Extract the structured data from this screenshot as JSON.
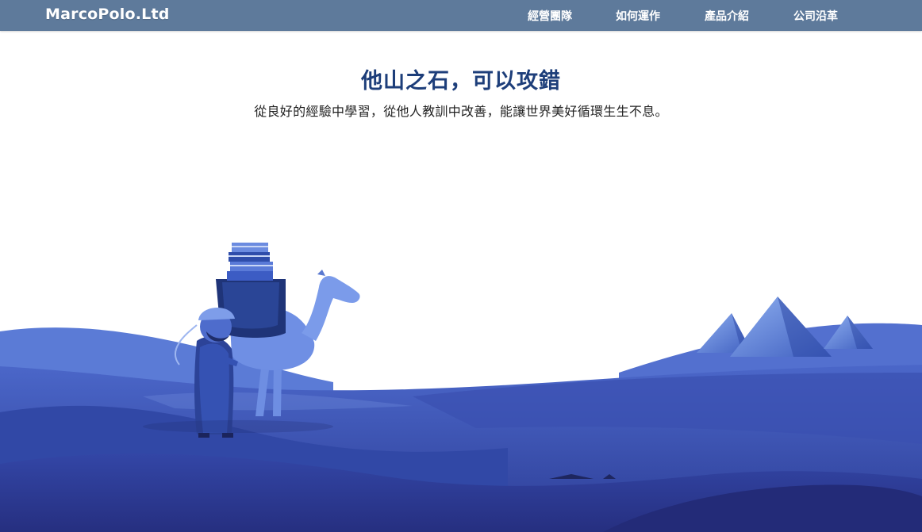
{
  "navbar": {
    "brand": "MarcoPolo.Ltd",
    "items": [
      {
        "label": "經營團隊"
      },
      {
        "label": "如何運作"
      },
      {
        "label": "產品介紹"
      },
      {
        "label": "公司沿革"
      }
    ]
  },
  "hero": {
    "title": "他山之石，可以攻錯",
    "subtitle": "從良好的經驗中學習，從他人教訓中改善，能讓世界美好循環生生不息。"
  },
  "colors": {
    "navbar_bg": "#5e7a9b",
    "title": "#1d3e7a",
    "desert_dark": "#2b3a8f",
    "desert_mid": "#3b55b5",
    "desert_light": "#6c8ad8"
  },
  "illustration": {
    "subjects": [
      "traveler-figure",
      "camel",
      "book-stack",
      "pyramids",
      "desert-dunes"
    ]
  }
}
